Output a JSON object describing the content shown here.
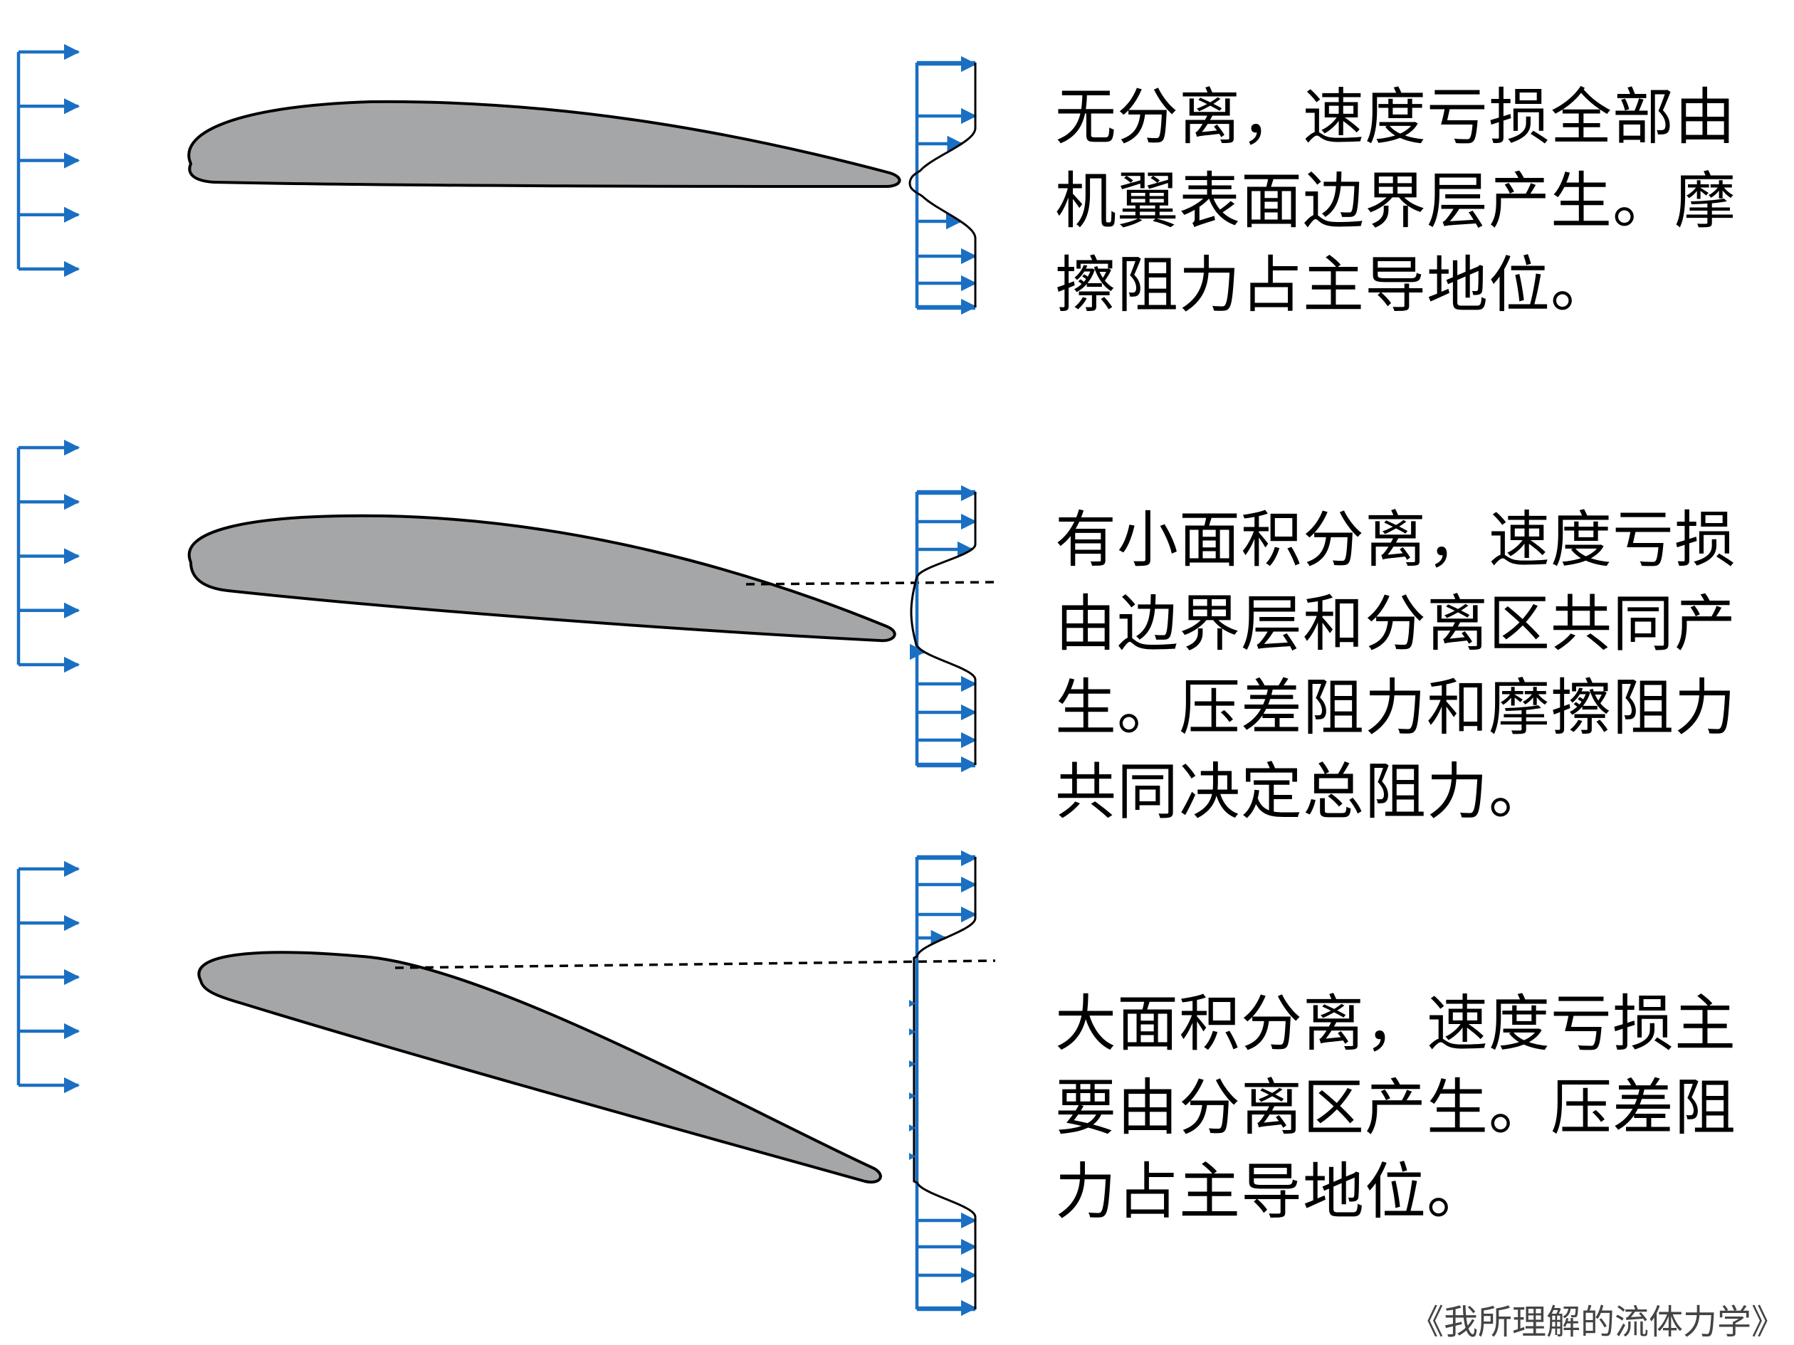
{
  "colors": {
    "arrow": "#1a6fc2",
    "airfoil_fill": "#a5a6a8",
    "outline": "#000000"
  },
  "cases": [
    {
      "id": "no-separation",
      "caption": "无分离，速度亏损全部由机翼表面边界层产生。摩擦阻力占主导地位。"
    },
    {
      "id": "small-separation",
      "caption": "有小面积分离，速度亏损由边界层和分离区共同产生。压差阻力和摩擦阻力共同决定总阻力。"
    },
    {
      "id": "large-separation",
      "caption": "大面积分离，速度亏损主要由分离区产生。压差阻力占主导地位。"
    }
  ],
  "source": "《我所理解的流体力学》"
}
